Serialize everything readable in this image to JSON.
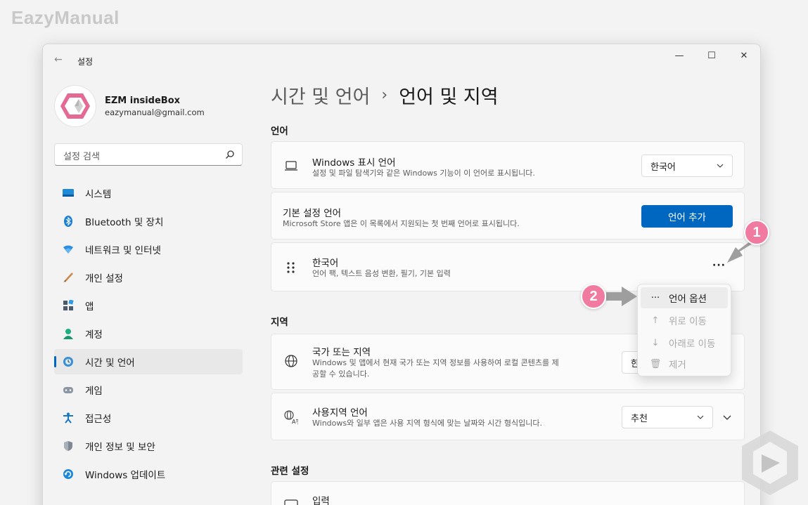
{
  "brand": "EazyManual",
  "window": {
    "title": "설정",
    "controls": {
      "minimize": "—",
      "maximize": "☐",
      "close": "✕"
    }
  },
  "profile": {
    "name": "EZM insideBox",
    "email": "eazymanual@gmail.com"
  },
  "search": {
    "placeholder": "설정 검색"
  },
  "nav": {
    "items": [
      {
        "label": "시스템",
        "icon": "system-icon"
      },
      {
        "label": "Bluetooth 및 장치",
        "icon": "bluetooth-icon"
      },
      {
        "label": "네트워크 및 인터넷",
        "icon": "network-icon"
      },
      {
        "label": "개인 설정",
        "icon": "personalization-icon"
      },
      {
        "label": "앱",
        "icon": "apps-icon"
      },
      {
        "label": "계정",
        "icon": "accounts-icon"
      },
      {
        "label": "시간 및 언어",
        "icon": "time-language-icon",
        "active": true
      },
      {
        "label": "게임",
        "icon": "gaming-icon"
      },
      {
        "label": "접근성",
        "icon": "accessibility-icon"
      },
      {
        "label": "개인 정보 및 보안",
        "icon": "privacy-icon"
      },
      {
        "label": "Windows 업데이트",
        "icon": "windows-update-icon"
      }
    ]
  },
  "breadcrumb": {
    "parent": "시간 및 언어",
    "separator": "›",
    "current": "언어 및 지역"
  },
  "language_section": {
    "title": "언어",
    "display_language": {
      "title": "Windows 표시 언어",
      "desc": "설정 및 파일 탐색기와 같은 Windows 기능이 이 언어로 표시됩니다.",
      "value": "한국어"
    },
    "preferred": {
      "title": "기본 설정 언어",
      "desc": "Microsoft Store 앱은 이 목록에서 지원되는 첫 번째 언어로 표시됩니다.",
      "button": "언어 추가"
    },
    "korean": {
      "title": "한국어",
      "desc": "언어 팩, 텍스트 음성 변환, 필기, 기본 입력",
      "more": "···"
    }
  },
  "context_menu": {
    "items": [
      {
        "label": "언어 옵션",
        "icon": "···",
        "state": "hover"
      },
      {
        "label": "위로 이동",
        "icon": "↑",
        "state": "disabled"
      },
      {
        "label": "아래로 이동",
        "icon": "↓",
        "state": "disabled"
      },
      {
        "label": "제거",
        "icon": "🗑",
        "state": "disabled"
      }
    ]
  },
  "region_section": {
    "title": "지역",
    "country": {
      "title": "국가 또는 지역",
      "desc1": "Windows 및 앱에서 현재 국가 또는 지역 정보를 사용하여 로컬 콘텐츠를 제",
      "desc2": "공할 수 있습니다.",
      "value": "한"
    },
    "format": {
      "title": "사용지역 언어",
      "desc": "Windows와 일부 앱은 사용 지역 형식에 맞는 날짜와 시간 형식입니다.",
      "value": "추천"
    }
  },
  "related_section": {
    "title": "관련 설정",
    "input": {
      "title": "입력"
    }
  },
  "annotations": {
    "badge1": "1",
    "badge2": "2"
  },
  "colors": {
    "accent": "#0067c0",
    "badge": "#f07aa0",
    "arrow": "#9e9e9e"
  }
}
